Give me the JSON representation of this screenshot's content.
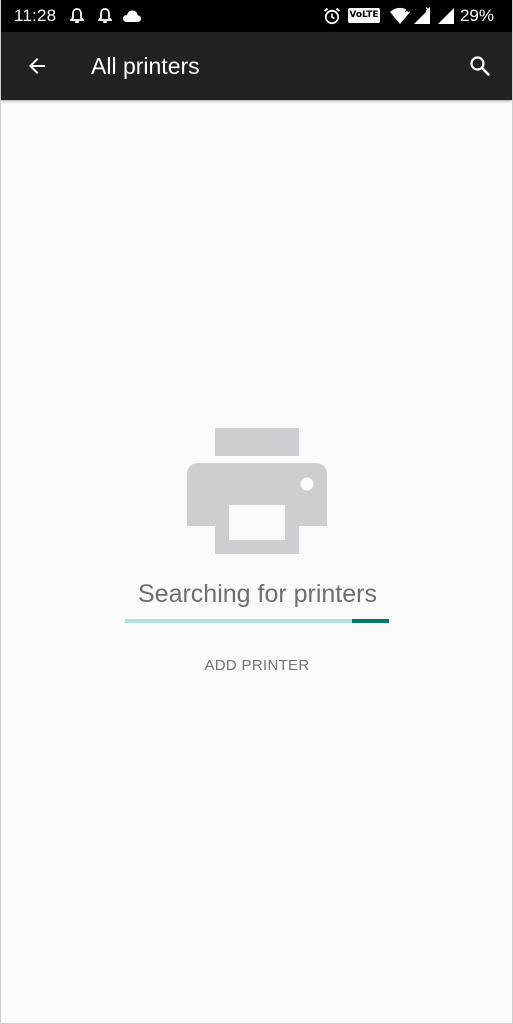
{
  "status_bar": {
    "time": "11:28",
    "volte": "VoLTE",
    "battery": "29%",
    "icons": [
      "notification-bell-icon",
      "notification-bell-icon",
      "cloud-icon",
      "alarm-icon",
      "volte-icon",
      "wifi-icon",
      "signal-icon",
      "signal-icon"
    ]
  },
  "app_bar": {
    "title": "All printers",
    "back_icon": "arrow-back-icon",
    "search_icon": "search-icon",
    "background": "#212121"
  },
  "empty_state": {
    "icon": "printer-icon",
    "message": "Searching for printers",
    "progress": {
      "type": "indeterminate",
      "fill_start_fraction": 0.86,
      "fill_end_fraction": 1.0,
      "track_color": "#b2dfdb",
      "fill_color": "#00796b"
    },
    "action_label": "ADD PRINTER"
  }
}
